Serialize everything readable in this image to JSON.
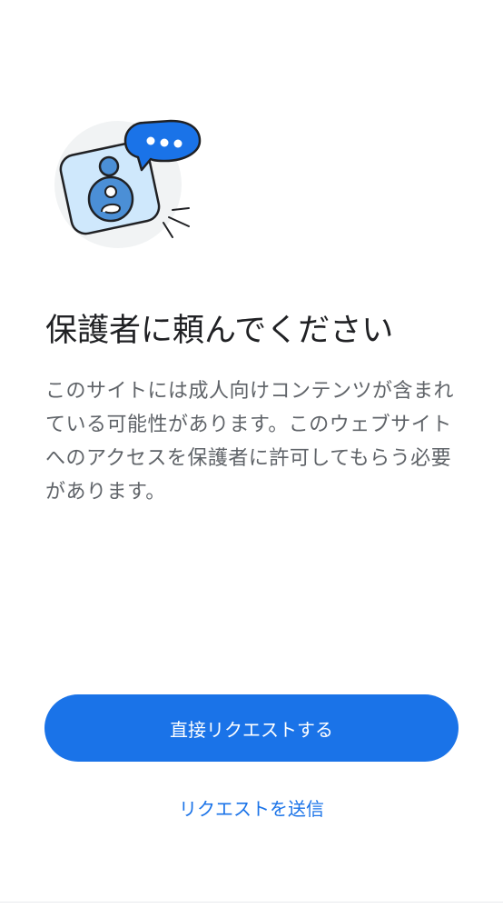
{
  "title": "保護者に頼んでください",
  "description": "このサイトには成人向けコンテンツが含まれている可能性があります。このウェブサイトへのアクセスを保護者に許可してもらう必要があります。",
  "primary_button": {
    "label": "直接リクエストする"
  },
  "secondary_link": {
    "label": "リクエストを送信"
  },
  "illustration": {
    "icon": "parent-request-illustration",
    "accent_color": "#1a73e8",
    "tile_color": "#cfe8fc",
    "circle_color": "#f1f3f4"
  }
}
